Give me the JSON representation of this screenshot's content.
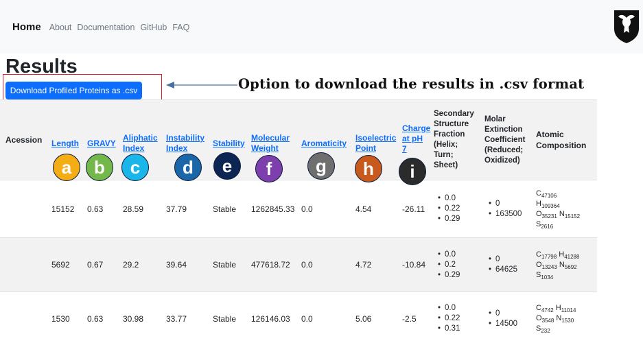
{
  "nav": {
    "brand": "Home",
    "links": [
      "About",
      "Documentation",
      "GitHub",
      "FAQ"
    ]
  },
  "page": {
    "title": "Results",
    "download_label": "Download Profiled Proteins as .csv",
    "callout": "Option to download the results in .csv format"
  },
  "colors": {
    "button": "#0d6efd",
    "highlight_box": "#e0232b",
    "badges": {
      "a": "#f5ad16",
      "b": "#74b74a",
      "c": "#1ab6ea",
      "d": "#1b66a8",
      "e": "#0c2552",
      "f": "#7d3fab",
      "g": "#6f6f6f",
      "h": "#c85a1e",
      "i": "#2b2b2b"
    }
  },
  "table": {
    "headers": {
      "accession": "Acession",
      "length": "Length",
      "gravy": "GRAVY",
      "aliphatic_1": "Aliphatic",
      "aliphatic_2": "Index",
      "instability_1": "Instability",
      "instability_2": "Index",
      "stability": "Stability",
      "molecular_1": "Molecular",
      "molecular_2": "Weight",
      "aromaticity": "Aromaticity",
      "isoelectric_1": "Isoelectric",
      "isoelectric_2": "Point",
      "charge_1": "Charge",
      "charge_2": "at pH",
      "charge_3": "7",
      "secondary_1": "Secondary",
      "secondary_2": "Structure",
      "secondary_3": "Fraction",
      "secondary_4": "(Helix;",
      "secondary_5": "Turn;",
      "secondary_6": "Sheet)",
      "molar_1": "Molar",
      "molar_2": "Extinction",
      "molar_3": "Coefficient",
      "molar_4": "(Reduced;",
      "molar_5": "Oxidized)",
      "atomic_1": "Atomic",
      "atomic_2": "Composition"
    },
    "badges": [
      "a",
      "b",
      "c",
      "d",
      "e",
      "f",
      "g",
      "h",
      "i"
    ],
    "rows": [
      {
        "length": "15152",
        "gravy": "0.63",
        "aliphatic": "28.59",
        "instability": "37.79",
        "stability": "Stable",
        "mw": "1262845.33",
        "aromaticity": "0.0",
        "pi": "4.54",
        "charge": "-26.11",
        "ss": [
          "0.0",
          "0.22",
          "0.29"
        ],
        "ext": [
          "0",
          "163500"
        ],
        "C": "47106",
        "H": "109364",
        "O": "35231",
        "N": "15152",
        "S": "2616"
      },
      {
        "length": "5692",
        "gravy": "0.67",
        "aliphatic": "29.2",
        "instability": "39.64",
        "stability": "Stable",
        "mw": "477618.72",
        "aromaticity": "0.0",
        "pi": "4.72",
        "charge": "-10.84",
        "ss": [
          "0.0",
          "0.2",
          "0.29"
        ],
        "ext": [
          "0",
          "64625"
        ],
        "C": "17798",
        "H": "41288",
        "O": "13243",
        "N": "5692",
        "S": "1034"
      },
      {
        "length": "1530",
        "gravy": "0.63",
        "aliphatic": "30.98",
        "instability": "33.77",
        "stability": "Stable",
        "mw": "126146.03",
        "aromaticity": "0.0",
        "pi": "5.06",
        "charge": "-2.5",
        "ss": [
          "0.0",
          "0.22",
          "0.31"
        ],
        "ext": [
          "0",
          "14500"
        ],
        "C": "4742",
        "H": "11014",
        "O": "3548",
        "N": "1530",
        "S": "232"
      }
    ]
  }
}
